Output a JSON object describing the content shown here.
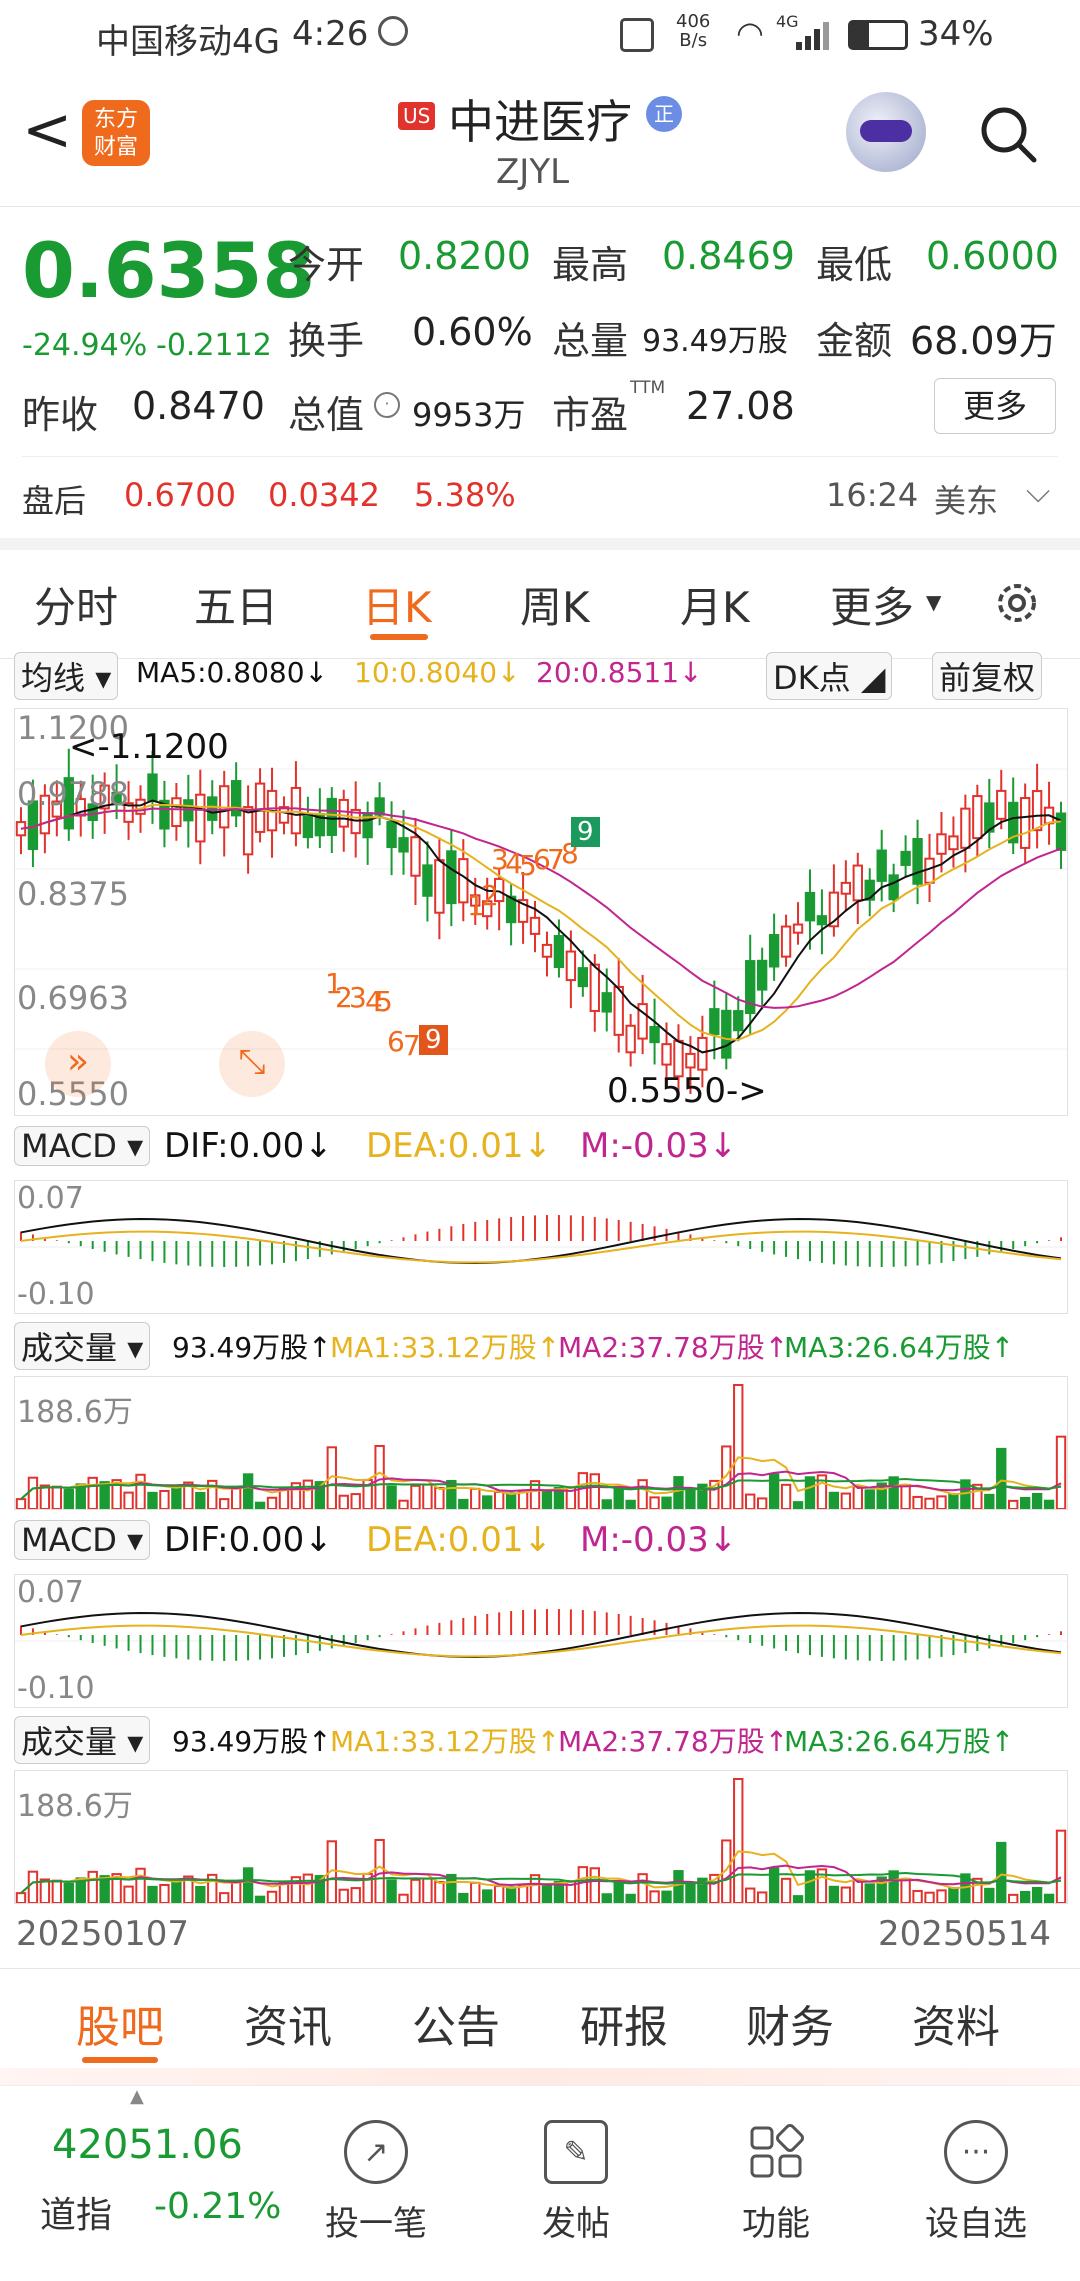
{
  "status_bar": {
    "carrier": "中国移动4G",
    "time": "4:26",
    "net_speed_top": "406",
    "net_speed_bottom": "B/s",
    "signal_type": "4G",
    "battery": "34%"
  },
  "header": {
    "app_logo_line1": "东方",
    "app_logo_line2": "财富",
    "market_badge": "US",
    "stock_name": "中进医疗",
    "name_badge": "正",
    "ticker": "ZJYL"
  },
  "quote": {
    "price": "0.6358",
    "change_pct": "-24.94%",
    "change_amt": "-0.2112",
    "open_label": "今开",
    "open": "0.8200",
    "high_label": "最高",
    "high": "0.8469",
    "low_label": "最低",
    "low": "0.6000",
    "turnover_label": "换手",
    "turnover": "0.60%",
    "volume_label": "总量",
    "volume": "93.49万股",
    "amount_label": "金额",
    "amount": "68.09万",
    "prev_close_label": "昨收",
    "prev_close": "0.8470",
    "mktcap_label": "总值",
    "mktcap": "9953万",
    "pe_label": "市盈",
    "pe_sup": "TTM",
    "pe": "27.08",
    "more_button": "更多",
    "after_label": "盘后",
    "after_price": "0.6700",
    "after_change": "0.0342",
    "after_pct": "5.38%",
    "after_time": "16:24",
    "after_zone": "美东"
  },
  "chart_tabs": [
    "分时",
    "五日",
    "日K",
    "周K",
    "月K",
    "更多"
  ],
  "active_tab": "日K",
  "ma_bar": {
    "selector": "均线",
    "ma5": "MA5:0.8080↓",
    "ma10": "10:0.8040↓",
    "ma20": "20:0.8511↓",
    "dk_button": "DK点",
    "fq_button": "前复权"
  },
  "kline": {
    "y_labels": [
      "1.1200",
      "0.9788",
      "0.8375",
      "0.6963",
      "0.5550"
    ],
    "max_annot": "<-1.1200",
    "min_annot": "0.5550->",
    "nine_up": [
      "1",
      "2",
      "3",
      "4",
      "5",
      "6",
      "7",
      "8",
      "9"
    ],
    "nine_down": [
      "1",
      "2",
      "3",
      "4",
      "5",
      "6",
      "7",
      "9"
    ]
  },
  "macd": {
    "selector": "MACD",
    "dif": "DIF:0.00↓",
    "dea": "DEA:0.01↓",
    "m": "M:-0.03↓",
    "top_label": "0.07",
    "bottom_label": "-0.10"
  },
  "volume": {
    "selector": "成交量",
    "value": "93.49万股↑",
    "ma1": "MA1:33.12万股↑",
    "ma2": "MA2:37.78万股↑",
    "ma3": "MA3:26.64万股↑",
    "top_label": "188.6万"
  },
  "date_range": {
    "start": "20250107",
    "end": "20250514"
  },
  "sub_tabs": [
    "股吧",
    "资讯",
    "公告",
    "研报",
    "财务",
    "资料"
  ],
  "active_sub_tab": "股吧",
  "bottom_bar": {
    "index_value": "42051.06",
    "index_name": "道指",
    "index_change": "-0.21%",
    "items": [
      "投一笔",
      "发帖",
      "功能",
      "设自选"
    ]
  },
  "colors": {
    "up": "#e1322c",
    "down": "#1a9a32",
    "accent": "#f06a1d",
    "ma5": "#111111",
    "ma10": "#e6b21e",
    "ma20": "#c0268f"
  }
}
